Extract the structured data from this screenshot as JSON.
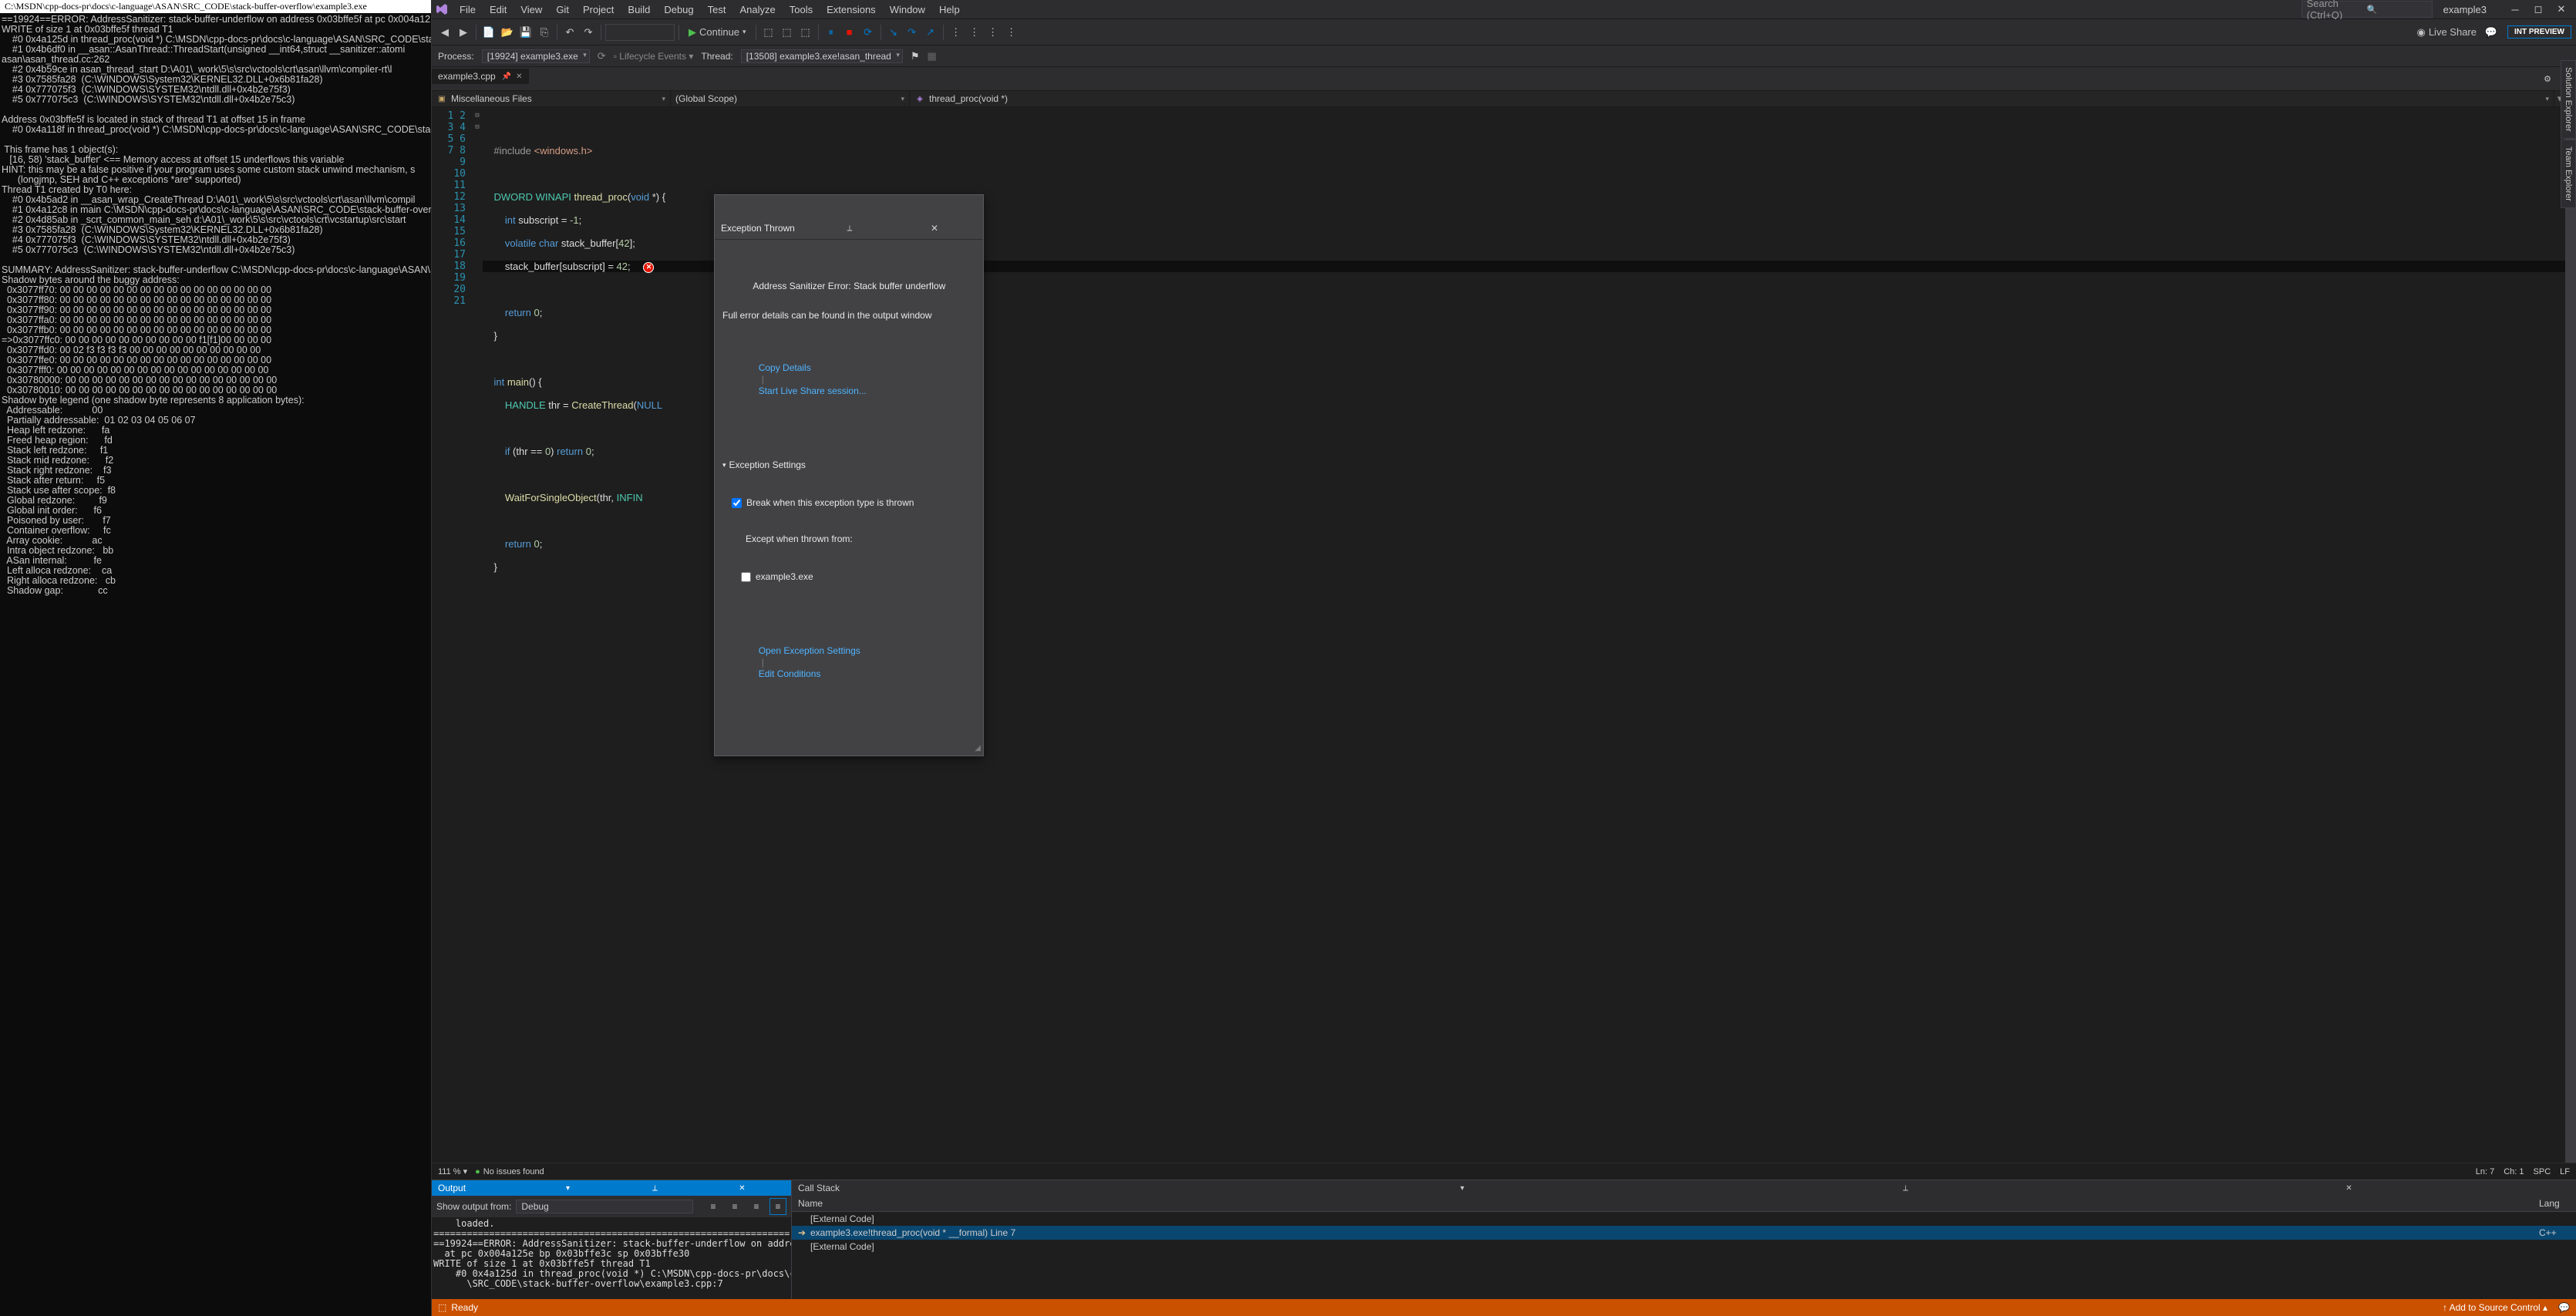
{
  "console": {
    "title": "C:\\MSDN\\cpp-docs-pr\\docs\\c-language\\ASAN\\SRC_CODE\\stack-buffer-overflow\\example3.exe",
    "body": "==19924==ERROR: AddressSanitizer: stack-buffer-underflow on address 0x03bffe5f at pc 0x004a12\nWRITE of size 1 at 0x03bffe5f thread T1\n    #0 0x4a125d in thread_proc(void *) C:\\MSDN\\cpp-docs-pr\\docs\\c-language\\ASAN\\SRC_CODE\\stac\n    #1 0x4b6df0 in __asan::AsanThread::ThreadStart(unsigned __int64,struct __sanitizer::atomi\nasan\\asan_thread.cc:262\n    #2 0x4b59ce in asan_thread_start D:\\A01\\_work\\5\\s\\src\\vctools\\crt\\asan\\llvm\\compiler-rt\\l\n    #3 0x7585fa28  (C:\\WINDOWS\\System32\\KERNEL32.DLL+0x6b81fa28)\n    #4 0x777075f3  (C:\\WINDOWS\\SYSTEM32\\ntdll.dll+0x4b2e75f3)\n    #5 0x777075c3  (C:\\WINDOWS\\SYSTEM32\\ntdll.dll+0x4b2e75c3)\n\nAddress 0x03bffe5f is located in stack of thread T1 at offset 15 in frame\n    #0 0x4a118f in thread_proc(void *) C:\\MSDN\\cpp-docs-pr\\docs\\c-language\\ASAN\\SRC_CODE\\stac\n\n This frame has 1 object(s):\n   [16, 58) 'stack_buffer' <== Memory access at offset 15 underflows this variable\nHINT: this may be a false positive if your program uses some custom stack unwind mechanism, s\n      (longjmp, SEH and C++ exceptions *are* supported)\nThread T1 created by T0 here:\n    #0 0x4b5ad2 in __asan_wrap_CreateThread D:\\A01\\_work\\5\\s\\src\\vctools\\crt\\asan\\llvm\\compil\n    #1 0x4a12c8 in main C:\\MSDN\\cpp-docs-pr\\docs\\c-language\\ASAN\\SRC_CODE\\stack-buffer-overfl\n    #2 0x4d85ab in _scrt_common_main_seh d:\\A01\\_work\\5\\s\\src\\vctools\\crt\\vcstartup\\src\\start\n    #3 0x7585fa28  (C:\\WINDOWS\\System32\\KERNEL32.DLL+0x6b81fa28)\n    #4 0x777075f3  (C:\\WINDOWS\\SYSTEM32\\ntdll.dll+0x4b2e75f3)\n    #5 0x777075c3  (C:\\WINDOWS\\SYSTEM32\\ntdll.dll+0x4b2e75c3)\n\nSUMMARY: AddressSanitizer: stack-buffer-underflow C:\\MSDN\\cpp-docs-pr\\docs\\c-language\\ASAN\\SR\nShadow bytes around the buggy address:\n  0x3077ff70: 00 00 00 00 00 00 00 00 00 00 00 00 00 00 00 00\n  0x3077ff80: 00 00 00 00 00 00 00 00 00 00 00 00 00 00 00 00\n  0x3077ff90: 00 00 00 00 00 00 00 00 00 00 00 00 00 00 00 00\n  0x3077ffa0: 00 00 00 00 00 00 00 00 00 00 00 00 00 00 00 00\n  0x3077ffb0: 00 00 00 00 00 00 00 00 00 00 00 00 00 00 00 00\n=>0x3077ffc0: 00 00 00 00 00 00 00 00 00 00 f1[f1]00 00 00 00\n  0x3077ffd0: 00 02 f3 f3 f3 f3 00 00 00 00 00 00 00 00 00 00\n  0x3077ffe0: 00 00 00 00 00 00 00 00 00 00 00 00 00 00 00 00\n  0x3077fff0: 00 00 00 00 00 00 00 00 00 00 00 00 00 00 00 00\n  0x30780000: 00 00 00 00 00 00 00 00 00 00 00 00 00 00 00 00\n  0x30780010: 00 00 00 00 00 00 00 00 00 00 00 00 00 00 00 00\nShadow byte legend (one shadow byte represents 8 application bytes):\n  Addressable:           00\n  Partially addressable:  01 02 03 04 05 06 07\n  Heap left redzone:      fa\n  Freed heap region:      fd\n  Stack left redzone:     f1\n  Stack mid redzone:      f2\n  Stack right redzone:    f3\n  Stack after return:     f5\n  Stack use after scope:  f8\n  Global redzone:         f9\n  Global init order:      f6\n  Poisoned by user:       f7\n  Container overflow:     fc\n  Array cookie:           ac\n  Intra object redzone:   bb\n  ASan internal:          fe\n  Left alloca redzone:    ca\n  Right alloca redzone:   cb\n  Shadow gap:             cc"
  },
  "menu": [
    "File",
    "Edit",
    "View",
    "Git",
    "Project",
    "Build",
    "Debug",
    "Test",
    "Analyze",
    "Tools",
    "Extensions",
    "Window",
    "Help"
  ],
  "search": {
    "placeholder": "Search (Ctrl+Q)"
  },
  "solution": "example3",
  "preview": "INT PREVIEW",
  "toolbar": {
    "continue": "Continue",
    "liveshare": "Live Share"
  },
  "debugbar": {
    "process_label": "Process:",
    "process": "[19924] example3.exe",
    "lifecycle": "Lifecycle Events",
    "thread_label": "Thread:",
    "thread": "[13508] example3.exe!asan_thread"
  },
  "tab": {
    "name": "example3.cpp"
  },
  "nav": {
    "a": "Miscellaneous Files",
    "b": "(Global Scope)",
    "c": "thread_proc(void *)"
  },
  "code": {
    "lines": 21
  },
  "exception": {
    "title": "Exception Thrown",
    "heading": "Address Sanitizer Error: Stack buffer underflow",
    "desc": "Full error details can be found in the output window",
    "copy": "Copy Details",
    "start": "Start Live Share session...",
    "settings_h": "Exception Settings",
    "break": "Break when this exception type is thrown",
    "except": "Except when thrown from:",
    "module": "example3.exe",
    "open": "Open Exception Settings",
    "edit": "Edit Conditions"
  },
  "status": {
    "zoom": "111 %",
    "issues": "No issues found",
    "ln": "Ln: 7",
    "ch": "Ch: 1",
    "spc": "SPC",
    "lf": "LF"
  },
  "output": {
    "title": "Output",
    "from_label": "Show output from:",
    "from": "Debug",
    "body": "    loaded.\n================================================================\n==19924==ERROR: AddressSanitizer: stack-buffer-underflow on address 0x03bffe5f \n  at pc 0x004a125e bp 0x03bffe3c sp 0x03bffe30\nWRITE of size 1 at 0x03bffe5f thread T1\n    #0 0x4a125d in thread_proc(void *) C:\\MSDN\\cpp-docs-pr\\docs\\c-language\\ASAN\n      \\SRC_CODE\\stack-buffer-overflow\\example3.cpp:7"
  },
  "callstack": {
    "title": "Call Stack",
    "name_h": "Name",
    "lang_h": "Lang",
    "rows": [
      {
        "name": "[External Code]",
        "lang": ""
      },
      {
        "name": "example3.exe!thread_proc(void * __formal) Line 7",
        "lang": "C++",
        "current": true
      },
      {
        "name": "[External Code]",
        "lang": ""
      }
    ]
  },
  "statusbar": {
    "ready": "Ready",
    "add": "Add to Source Control"
  },
  "sidetabs": [
    "Solution Explorer",
    "Team Explorer"
  ]
}
